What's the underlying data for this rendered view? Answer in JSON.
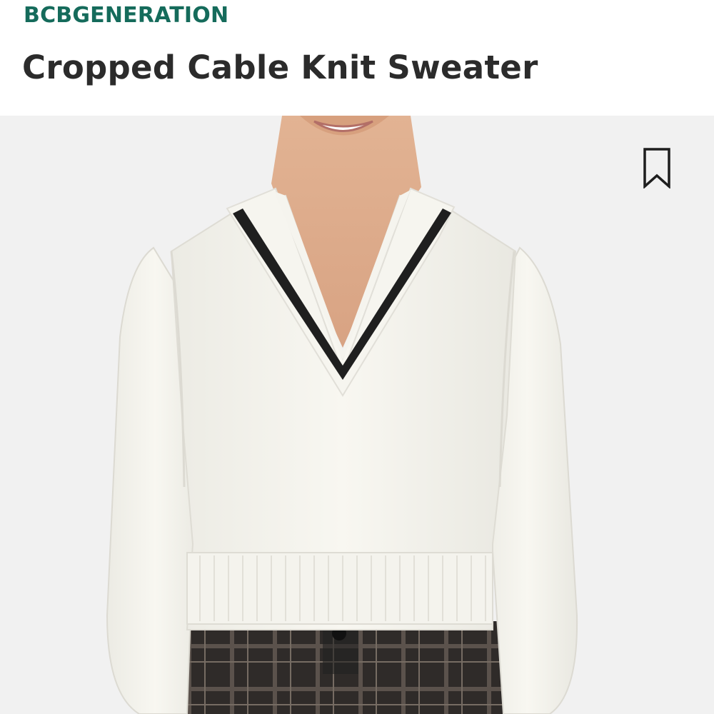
{
  "product": {
    "brand": "BCBGENERATION",
    "title": "Cropped Cable Knit Sweater"
  },
  "image": {
    "subject": "cream-v-neck-sweater-photo"
  },
  "actions": {
    "bookmark_icon": "bookmark-icon"
  },
  "colors": {
    "brand": "#156b5b",
    "title": "#2b2b2b",
    "image_background": "#f1f1f1"
  }
}
